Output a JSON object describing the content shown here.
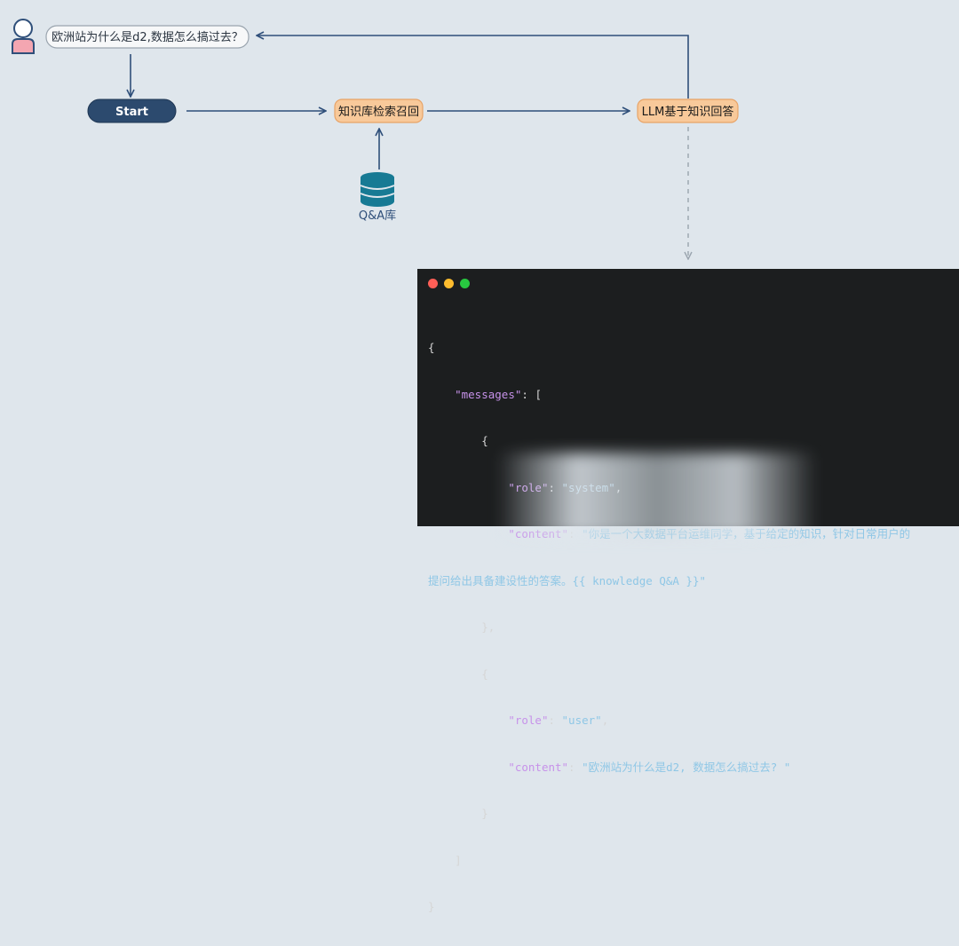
{
  "question": "欧洲站为什么是d2,数据怎么搞过去？",
  "nodes": {
    "start": "Start",
    "retrieve": "知识库检索召回",
    "llm": "LLM基于知识回答",
    "kb": "Q&A库"
  },
  "colors": {
    "background": "#dfe6ec",
    "start_fill": "#2c4a6e",
    "node_fill": "#f8c99a",
    "node_stroke": "#e8a366",
    "arrow": "#2f4f7a",
    "db": "#177a94",
    "code_bg": "#1c1e1f",
    "json_key": "#c792ea",
    "json_string": "#8fc7e6"
  },
  "icons": [
    "user-icon",
    "database-icon"
  ],
  "window_dots": [
    "#ff5f57",
    "#febc2e",
    "#28c840"
  ],
  "code": {
    "open_brace": "{",
    "messages_key": "\"messages\"",
    "open_bracket": "[",
    "obj_open": "{",
    "role_key": "\"role\"",
    "content_key": "\"content\"",
    "system_role": "\"system\"",
    "system_content_1": "\"你是一个大数据平台运维同学，基于给定的知识，针对日常用户的",
    "system_content_2": "提问给出具备建设性的答案。{{ knowledge Q&A }}\"",
    "obj_close_comma": "},",
    "user_role": "\"user\"",
    "user_content": "\"欧洲站为什么是d2, 数据怎么搞过去? \"",
    "obj_close": "}",
    "close_bracket": "]",
    "close_brace": "}"
  }
}
